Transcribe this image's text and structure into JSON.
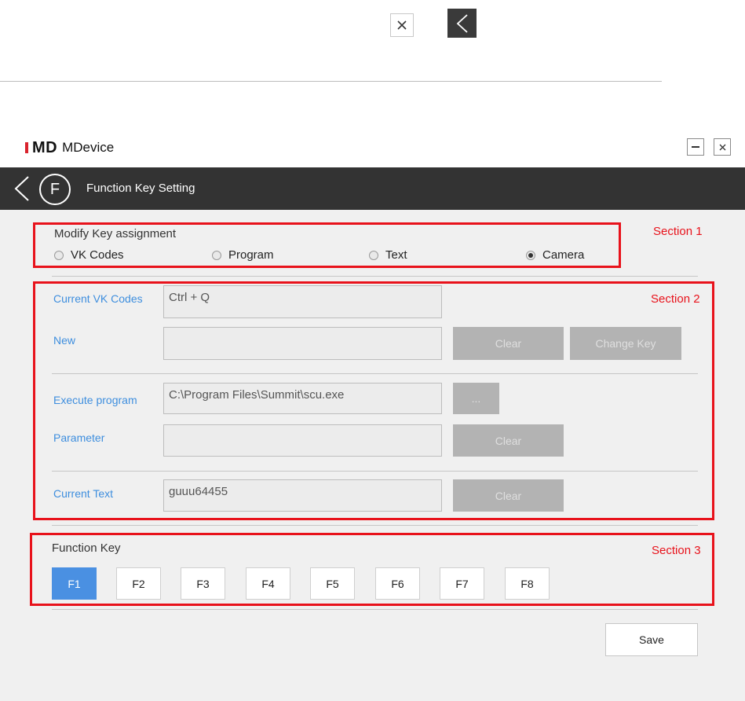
{
  "top_icons": {
    "close": "close-icon",
    "back": "chevron-left-icon"
  },
  "app": {
    "logo": "MD",
    "name": "MDevice",
    "minimize_icon": "minus-icon",
    "close_icon": "close-icon"
  },
  "titlebar": {
    "title": "Function Key Setting",
    "badge": "F"
  },
  "section1": {
    "label": "Section 1",
    "heading": "Modify Key assignment",
    "options": [
      {
        "label": "VK Codes",
        "checked": false
      },
      {
        "label": "Program",
        "checked": false
      },
      {
        "label": "Text",
        "checked": false
      },
      {
        "label": "Camera",
        "checked": true
      }
    ]
  },
  "section2": {
    "label": "Section 2",
    "current_vk_label": "Current VK Codes",
    "current_vk_value": "Ctrl + Q",
    "new_label": "New",
    "new_value": "",
    "clear_label": "Clear",
    "change_key_label": "Change Key",
    "execute_label": "Execute program",
    "execute_value": "C:\\Program Files\\Summit\\scu.exe",
    "browse_label": "...",
    "parameter_label": "Parameter",
    "parameter_value": "",
    "param_clear_label": "Clear",
    "current_text_label": "Current Text",
    "current_text_value": "guuu64455",
    "text_clear_label": "Clear"
  },
  "section3": {
    "label": "Section 3",
    "heading": "Function Key",
    "keys": [
      "F1",
      "F2",
      "F3",
      "F4",
      "F5",
      "F6",
      "F7",
      "F8"
    ],
    "active": "F1"
  },
  "save_label": "Save",
  "colors": {
    "accent": "#4a90e2",
    "highlight": "#e8121b",
    "titlebar": "#333333",
    "brand_red": "#d9232d"
  }
}
